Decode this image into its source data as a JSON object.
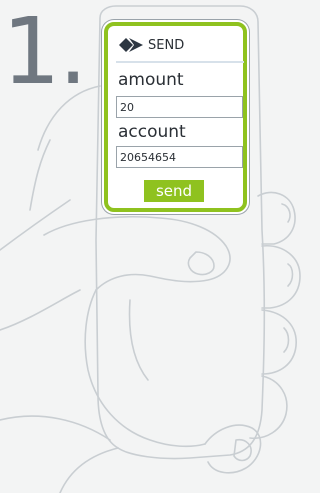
{
  "step": {
    "number": "1."
  },
  "screen": {
    "header": {
      "icon": "send-arrow-icon",
      "title": "SEND"
    },
    "amount": {
      "label": "amount",
      "value": "20"
    },
    "account": {
      "label": "account",
      "value": "20654654"
    },
    "send_button": {
      "label": "send"
    }
  },
  "colors": {
    "accent_green": "#8fc21f",
    "icon_dark": "#2d3742",
    "step_number_gray": "#6f7780",
    "outline_gray": "#c9ced2"
  }
}
